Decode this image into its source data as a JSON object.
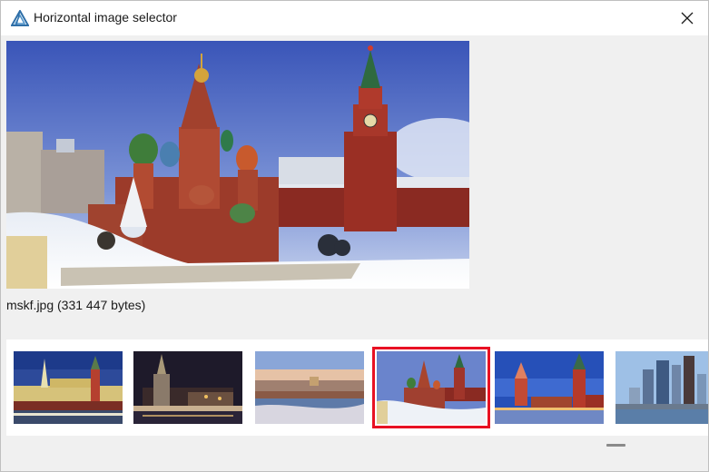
{
  "window": {
    "title": "Horizontal image selector",
    "app_icon": "triangle-logo-icon",
    "close_icon": "close-icon"
  },
  "preview": {
    "caption": "mskf.jpg (331 447 bytes)",
    "image": "st-basils-cathedral-winter-photo"
  },
  "thumbnails": [
    {
      "image": "kremlin-embankment-evening",
      "selected": false
    },
    {
      "image": "stalinist-skyscraper-night",
      "selected": false
    },
    {
      "image": "moscow-river-sunset",
      "selected": false
    },
    {
      "image": "st-basils-cathedral-winter",
      "selected": true
    },
    {
      "image": "red-square-towers-dusk",
      "selected": false
    },
    {
      "image": "moscow-city-skyscrapers",
      "selected": false
    }
  ],
  "colors": {
    "selection_border": "#e81123",
    "window_background": "#f0f0f0",
    "titlebar": "#ffffff"
  }
}
